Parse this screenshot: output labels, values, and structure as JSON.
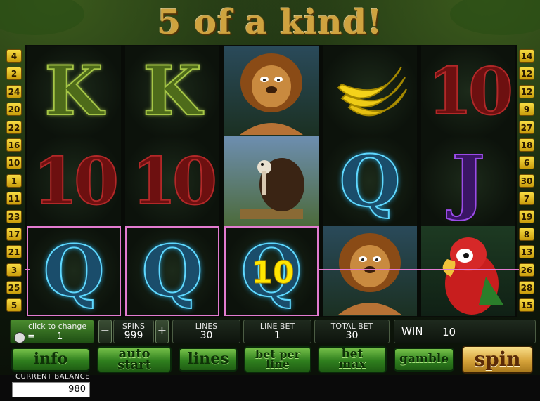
{
  "game": {
    "title": "5 of a kind!"
  },
  "line_numbers": {
    "left": [
      "4",
      "2",
      "24",
      "20",
      "22",
      "16",
      "10",
      "1",
      "11",
      "23",
      "17",
      "21",
      "3",
      "25",
      "5"
    ],
    "right": [
      "14",
      "12",
      "12",
      "9",
      "27",
      "18",
      "6",
      "30",
      "7",
      "19",
      "8",
      "13",
      "26",
      "28",
      "15"
    ]
  },
  "reels": [
    {
      "symbols": [
        {
          "type": "K",
          "label": "K"
        },
        {
          "type": "10",
          "label": "10"
        },
        {
          "type": "Q",
          "label": "Q"
        }
      ]
    },
    {
      "symbols": [
        {
          "type": "K",
          "label": "K"
        },
        {
          "type": "10",
          "label": "10"
        },
        {
          "type": "Q",
          "label": "Q"
        }
      ]
    },
    {
      "symbols": [
        {
          "type": "lion",
          "label": ""
        },
        {
          "type": "vulture",
          "label": ""
        },
        {
          "type": "Q",
          "label": "Q"
        }
      ]
    },
    {
      "symbols": [
        {
          "type": "banana",
          "label": ""
        },
        {
          "type": "Q",
          "label": "Q"
        },
        {
          "type": "lion",
          "label": ""
        }
      ]
    },
    {
      "symbols": [
        {
          "type": "10",
          "label": "10"
        },
        {
          "type": "J",
          "label": "J"
        },
        {
          "type": "parrot",
          "label": ""
        }
      ]
    }
  ],
  "win_overlay": "10",
  "controls": {
    "click_to_change": "click to change",
    "coin_value": "1",
    "coin_equals": "=",
    "spins_label": "SPINS",
    "spins_value": "999",
    "minus": "−",
    "plus": "+",
    "lines_label": "LINES",
    "lines_value": "30",
    "line_bet_label": "LINE BET",
    "line_bet_value": "1",
    "total_bet_label": "TOTAL BET",
    "total_bet_value": "30",
    "win_label": "WIN",
    "win_value": "10"
  },
  "buttons": {
    "info": "info",
    "auto_start_1": "auto",
    "auto_start_2": "start",
    "lines": "lines",
    "bet_per_line_1": "bet per",
    "bet_per_line_2": "line",
    "bet_max_1": "bet",
    "bet_max_2": "max",
    "gamble": "gamble",
    "spin": "spin"
  },
  "balance": {
    "label": "CURRENT BALANCE",
    "value": "980"
  },
  "colors": {
    "accent_gold": "#cfa33f",
    "payline": "#e27bd0",
    "button_green": "#2f7f1e"
  }
}
